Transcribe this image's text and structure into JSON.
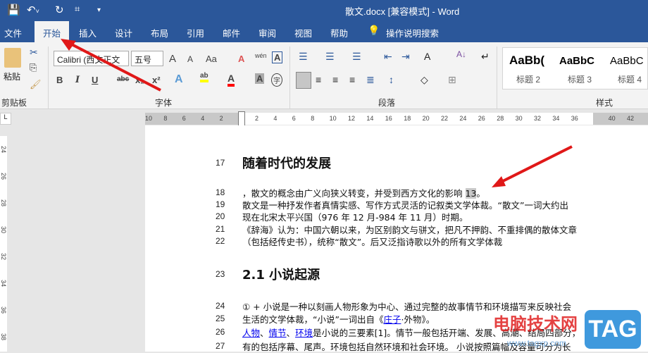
{
  "window": {
    "title": "散文.docx [兼容模式]  -  Word"
  },
  "qat": {
    "save": "save-icon",
    "undo": "undo-icon",
    "redo": "redo-icon",
    "touch": "touch-mode-icon",
    "customize": "customize-icon"
  },
  "tabs": [
    "文件",
    "开始",
    "插入",
    "设计",
    "布局",
    "引用",
    "邮件",
    "审阅",
    "视图",
    "帮助"
  ],
  "tell_me": "操作说明搜索",
  "ribbon": {
    "clipboard": {
      "paste": "粘贴",
      "label": "剪贴板"
    },
    "font": {
      "name": "Calibri (西文正文",
      "size": "五号",
      "label": "字体",
      "bold": "B",
      "italic": "I",
      "underline": "U",
      "strike": "abc",
      "sub": "x₂",
      "sup": "x²",
      "grow": "A",
      "shrink": "A",
      "case": "Aa",
      "phonetic": "wén",
      "border_char": "A",
      "shade_char": "A",
      "enclose": "字"
    },
    "paragraph": {
      "label": "段落"
    },
    "styles": {
      "label": "样式",
      "items": [
        {
          "preview": "AaBb(",
          "name": "标题 2"
        },
        {
          "preview": "AaBbC",
          "name": "标题 3"
        },
        {
          "preview": "AaBbC",
          "name": "标题 4"
        }
      ]
    },
    "accent_highlight": "#ffff00",
    "accent_fontcolor": "#ff0000"
  },
  "ruler": {
    "left": [
      "10",
      "8",
      "6",
      "4",
      "2"
    ],
    "right": [
      "2",
      "4",
      "6",
      "8",
      "10",
      "12",
      "14",
      "16",
      "18",
      "20",
      "22",
      "24",
      "26",
      "28",
      "30",
      "32",
      "34",
      "36",
      "40",
      "42"
    ]
  },
  "vruler": [
    "24",
    "26",
    "28",
    "30",
    "32",
    "34",
    "36",
    "38"
  ],
  "doc": {
    "l17": {
      "n": "17",
      "t": "随着时代的发展"
    },
    "l18": {
      "n": "18",
      "t": "，散文的概念由广义向狭义转变，并受到西方文化的影响",
      "ref": "13",
      "end": "。"
    },
    "l19": {
      "n": "19",
      "t": "散文是一种抒发作者真情实感、写作方式灵活的记叙类文学体裁。“散文”一词大约出"
    },
    "l20": {
      "n": "20",
      "t": "现在北宋太平兴国（976 年 12 月-984 年 11 月）时期。"
    },
    "l21": {
      "n": "21",
      "t": "《辞海》认为：中国六朝以来，为区别韵文与骈文，把凡不押韵、不重排偶的散体文章"
    },
    "l22": {
      "n": "22",
      "t": "（包括经传史书），统称“散文”。后又泛指诗歌以外的所有文学体裁"
    },
    "l23": {
      "n": "23",
      "t": "2.1 小说起源"
    },
    "l24": {
      "n": "24",
      "t": "① + 小说是一种以刻画人物形象为中心、通过完整的故事情节和环境描写来反映社会"
    },
    "l25": {
      "n": "25",
      "a": "生活的文学体裁，“小说”一词出自《",
      "link": "庄子",
      "b": "·外物》。"
    },
    "l26": {
      "n": "26",
      "k1": "人物",
      "s1": "、",
      "k2": "情节",
      "s2": "、",
      "k3": "环境",
      "rest": "是小说的三要素[1]。情节一般包括开端、发展、高潮、结局四部分，"
    },
    "l27": {
      "n": "27",
      "t": "有的包括序幕、尾声。环境包括自然环境和社会环境。 小说按照篇幅及容量可分为长"
    }
  },
  "watermark": {
    "text": "电脑技术网",
    "url": "www.tagxp.com",
    "logo": "TAG"
  }
}
